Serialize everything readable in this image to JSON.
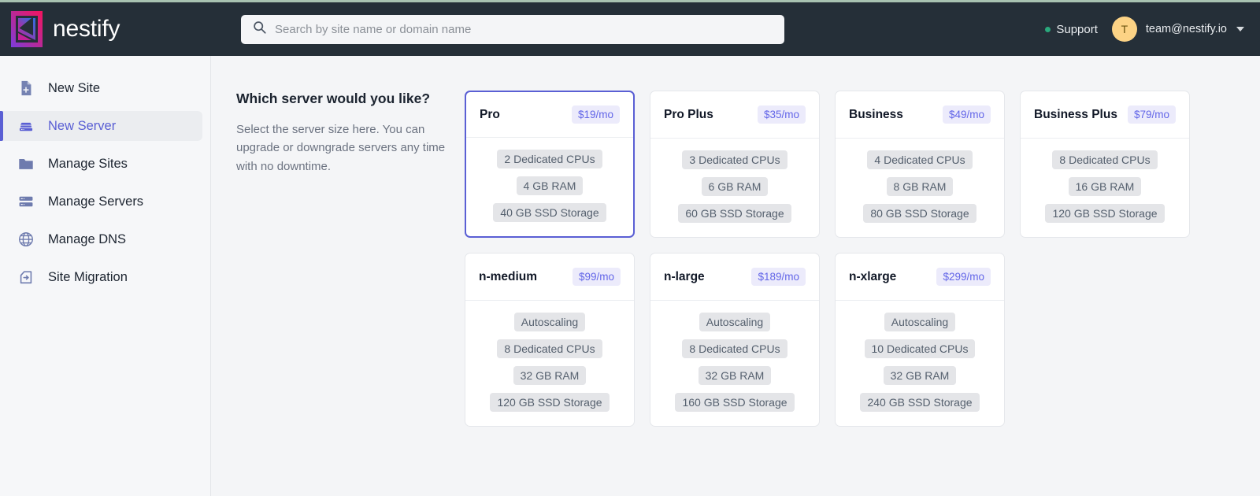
{
  "header": {
    "brand_name": "nestify",
    "logo_icon": "nestify-logo",
    "search": {
      "icon": "search-icon",
      "placeholder": "Search by site name or domain name",
      "value": ""
    },
    "support_label": "Support",
    "support_status_color": "#2aa87c",
    "avatar_initial": "T",
    "account_email": "team@nestify.io",
    "caret_icon": "chevron-down-icon",
    "background_color": "#252f38",
    "accent_strip_color": "#a8c2b1"
  },
  "sidebar": {
    "active_color": "#5a5fd4",
    "items": [
      {
        "label": "New Site",
        "icon": "document-plus-icon",
        "active": false
      },
      {
        "label": "New Server",
        "icon": "server-icon",
        "active": true
      },
      {
        "label": "Manage Sites",
        "icon": "folder-icon",
        "active": false
      },
      {
        "label": "Manage Servers",
        "icon": "server-rack-icon",
        "active": false
      },
      {
        "label": "Manage DNS",
        "icon": "globe-icon",
        "active": false
      },
      {
        "label": "Site Migration",
        "icon": "migration-tag-icon",
        "active": false
      }
    ]
  },
  "main": {
    "intro": {
      "title": "Which server would you like?",
      "description": "Select the server size here. You can upgrade or downgrade servers any time with no downtime."
    },
    "selected_border_color": "#5a5fd4",
    "price_badge_bg": "#ecebfb",
    "price_badge_color": "#6366e8",
    "spec_chip_bg": "#e4e5e8",
    "plan_rows": [
      [
        {
          "name": "Pro",
          "price": "$19/mo",
          "selected": true,
          "specs": [
            "2 Dedicated CPUs",
            "4 GB RAM",
            "40 GB SSD Storage"
          ]
        },
        {
          "name": "Pro Plus",
          "price": "$35/mo",
          "selected": false,
          "specs": [
            "3 Dedicated CPUs",
            "6 GB RAM",
            "60 GB SSD Storage"
          ]
        },
        {
          "name": "Business",
          "price": "$49/mo",
          "selected": false,
          "specs": [
            "4 Dedicated CPUs",
            "8 GB RAM",
            "80 GB SSD Storage"
          ]
        },
        {
          "name": "Business Plus",
          "price": "$79/mo",
          "selected": false,
          "specs": [
            "8 Dedicated CPUs",
            "16 GB RAM",
            "120 GB SSD Storage"
          ]
        }
      ],
      [
        {
          "name": "n-medium",
          "price": "$99/mo",
          "selected": false,
          "specs": [
            "Autoscaling",
            "8 Dedicated CPUs",
            "32 GB RAM",
            "120 GB SSD Storage"
          ]
        },
        {
          "name": "n-large",
          "price": "$189/mo",
          "selected": false,
          "specs": [
            "Autoscaling",
            "8 Dedicated CPUs",
            "32 GB RAM",
            "160 GB SSD Storage"
          ]
        },
        {
          "name": "n-xlarge",
          "price": "$299/mo",
          "selected": false,
          "specs": [
            "Autoscaling",
            "10 Dedicated CPUs",
            "32 GB RAM",
            "240 GB SSD Storage"
          ]
        }
      ]
    ]
  }
}
